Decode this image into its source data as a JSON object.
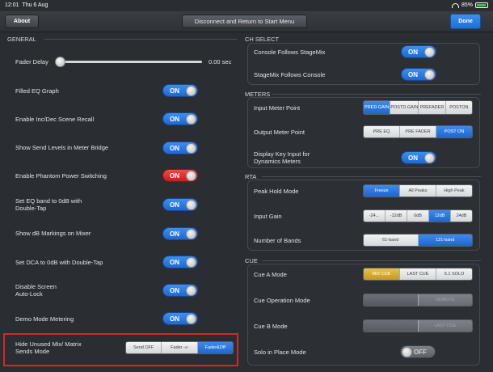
{
  "status": {
    "time": "12:01",
    "date": "Thu 6 Aug",
    "battery": "85%"
  },
  "topbar": {
    "about": "About",
    "disconnect": "Disconnect and Return to Start Menu",
    "done": "Done"
  },
  "general": {
    "title": "GENERAL",
    "fader_delay": {
      "label": "Fader Delay",
      "value": "0.00 sec",
      "position": 0
    },
    "rows": [
      {
        "label": "Filled EQ Graph",
        "state": "ON"
      },
      {
        "label": "Enable Inc/Dec Scene Recall",
        "state": "ON"
      },
      {
        "label": "Show Send Levels in Meter Bridge",
        "state": "ON"
      },
      {
        "label": "Enable Phantom Power Switching",
        "state": "ON"
      },
      {
        "label": "Set EQ band to 0dB with",
        "label2": "Double-Tap",
        "state": "ON"
      },
      {
        "label": "Show dB Markings on Mixer",
        "state": "ON"
      },
      {
        "label": "Set DCA to 0dB with Double-Tap",
        "state": "ON"
      },
      {
        "label": "Disable Screen",
        "label2": "Auto-Lock",
        "state": "ON"
      },
      {
        "label": "Demo Mode Metering",
        "state": "ON"
      }
    ],
    "hide_unused": {
      "label": "Hide Unused Mix/ Matrix",
      "label2": "Sends Mode",
      "options": [
        "Send OFF",
        "Fader -∞",
        "Fader&Off"
      ]
    }
  },
  "ch_select": {
    "title": "CH SELECT",
    "rows": [
      {
        "label": "Console Follows StageMix",
        "state": "ON"
      },
      {
        "label": "StageMix Follows Console",
        "state": "ON"
      }
    ]
  },
  "meters": {
    "title": "METERS",
    "input_point": {
      "label": "Input Meter Point",
      "options": [
        [
          "PRE",
          "D.GAIN"
        ],
        [
          "POST",
          "D.GAIN"
        ],
        [
          "PRE",
          "FADER"
        ],
        [
          "POST",
          "ON"
        ]
      ]
    },
    "output_point": {
      "label": "Output Meter Point",
      "options": [
        "PRE EQ",
        "PRE FADER",
        "POST ON"
      ]
    },
    "display_key": {
      "label": "Display Key Input for",
      "label2": "Dynamics Meters",
      "state": "ON"
    }
  },
  "rta": {
    "title": "RTA",
    "peak_hold": {
      "label": "Peak Hold Mode",
      "options": [
        "Freeze",
        "All Peaks",
        "High Peak"
      ]
    },
    "input_gain": {
      "label": "Input Gain",
      "options": [
        "-24...",
        "-12dB",
        "0dB",
        "12dB",
        "24dB"
      ]
    },
    "bands": {
      "label": "Number of Bands",
      "options": [
        "61-band",
        "121-band"
      ]
    }
  },
  "cue": {
    "title": "CUE",
    "cue_a": {
      "label": "Cue A Mode",
      "options": [
        "MIX CUE",
        "LAST CUE",
        "5.1 SOLO"
      ]
    },
    "operation": {
      "label": "Cue Operation Mode",
      "options": [
        "",
        "REMOTE"
      ]
    },
    "cue_b": {
      "label": "Cue B Mode",
      "options": [
        "",
        "LAST CUE"
      ]
    },
    "solo": {
      "label": "Solo in Place Mode",
      "state": "OFF"
    }
  }
}
